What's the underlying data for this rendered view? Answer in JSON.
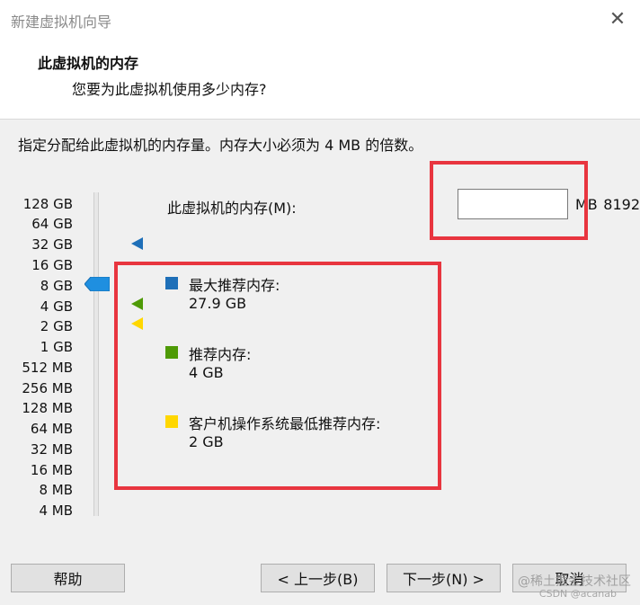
{
  "window": {
    "title": "新建虚拟机向导",
    "close_glyph": "✕"
  },
  "header": {
    "title": "此虚拟机的内存",
    "subtitle": "您要为此虚拟机使用多少内存?"
  },
  "instruction": "指定分配给此虚拟机的内存量。内存大小必须为 4 MB 的倍数。",
  "scale": {
    "ticks": [
      "128 GB",
      "64 GB",
      "32 GB",
      "16 GB",
      "8 GB",
      "4 GB",
      "2 GB",
      "1 GB",
      "512 MB",
      "256 MB",
      "128 MB",
      "64 MB",
      "32 MB",
      "16 MB",
      "8 MB",
      "4 MB"
    ],
    "slider_value": "8 GB"
  },
  "memory": {
    "label": "此虚拟机的内存(M):",
    "value": "8192",
    "unit": "MB"
  },
  "legend": {
    "max_title": "最大推荐内存:",
    "max_value": "27.9 GB",
    "rec_title": "推荐内存:",
    "rec_value": "4 GB",
    "min_title": "客户机操作系统最低推荐内存:",
    "min_value": "2 GB"
  },
  "colors": {
    "max": "#1e6fb8",
    "recommended": "#4e9a06",
    "minimum": "#ffd700",
    "slider_thumb": "#1f8fe0",
    "highlight": "#e8353f"
  },
  "buttons": {
    "help": "帮助",
    "back": "< 上一步(B)",
    "next": "下一步(N) >",
    "cancel": "取消"
  },
  "watermark": {
    "line1": "@稀土掘金技术社区",
    "line2": "CSDN @acanab"
  }
}
